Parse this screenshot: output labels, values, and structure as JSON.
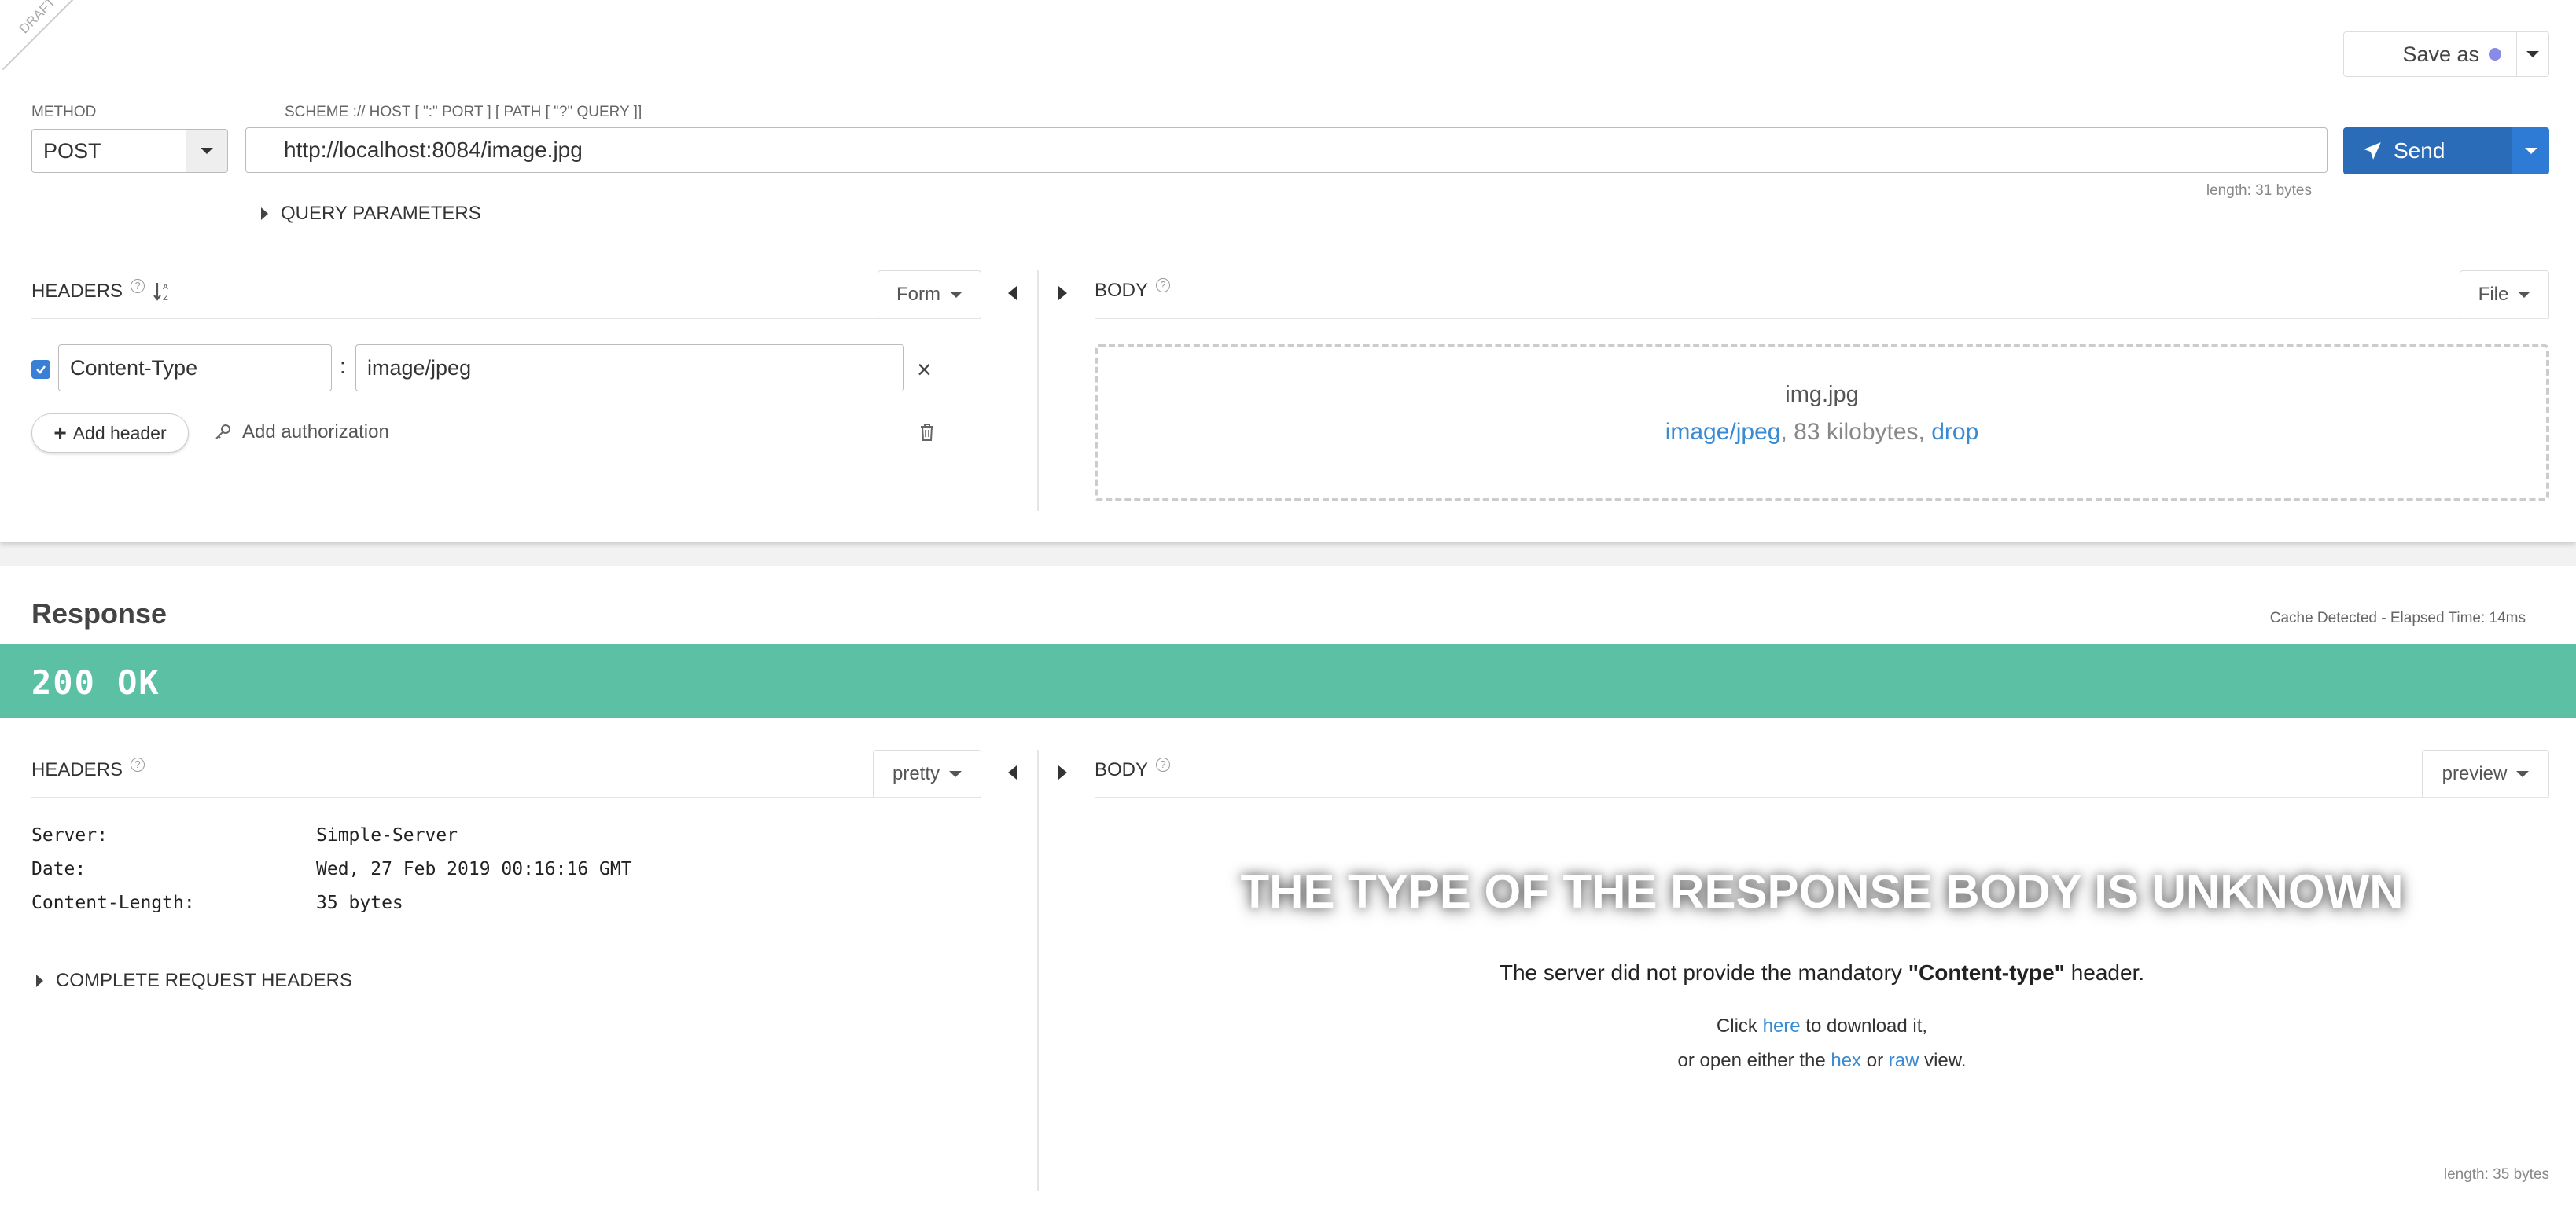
{
  "request": {
    "draft_label": "DRAFT",
    "save_as_label": "Save as",
    "method_label": "METHOD",
    "method_value": "POST",
    "url_label": "SCHEME :// HOST [ \":\" PORT ] [ PATH [ \"?\" QUERY ]]",
    "url_value": "http://localhost:8084/image.jpg",
    "url_length": "length: 31 bytes",
    "send_label": "Send",
    "query_params_label": "QUERY PARAMETERS",
    "headers_label": "HEADERS",
    "headers_mode": "Form",
    "header_rows": [
      {
        "enabled": true,
        "name": "Content-Type",
        "value": "image/jpeg"
      }
    ],
    "add_header_label": "Add header",
    "add_auth_label": "Add authorization",
    "body_label": "BODY",
    "body_mode": "File",
    "file": {
      "name": "img.jpg",
      "mime": "image/jpeg",
      "size": ", 83 kilobytes, ",
      "drop_label": "drop"
    }
  },
  "response": {
    "title": "Response",
    "cache_info": "Cache Detected -  Elapsed Time: 14ms",
    "status": "200 OK",
    "headers_label": "HEADERS",
    "headers_mode": "pretty",
    "headers": [
      {
        "name": "Server:",
        "value": "Simple-Server"
      },
      {
        "name": "Date:",
        "value": "Wed, 27 Feb 2019 00:16:16 GMT"
      },
      {
        "name": "Content-Length:",
        "value": "35 bytes"
      }
    ],
    "complete_request_headers_label": "COMPLETE REQUEST HEADERS",
    "body_label": "BODY",
    "body_mode": "preview",
    "unknown_title": "THE TYPE OF THE RESPONSE BODY IS UNKNOWN",
    "missing_header_pre": "The server did not provide the mandatory ",
    "missing_header_name": "\"Content-type\"",
    "missing_header_post": " header.",
    "click_text": "Click ",
    "here_link": "here",
    "download_text": " to download it,",
    "open_text": "or open either the ",
    "hex_link": "hex",
    "or_text": " or ",
    "raw_link": "raw",
    "view_text": " view.",
    "body_length": "length: 35 bytes"
  },
  "colors": {
    "primary": "#2b6cb8",
    "status_ok": "#5cc0a5",
    "link": "#3a8ad4"
  }
}
